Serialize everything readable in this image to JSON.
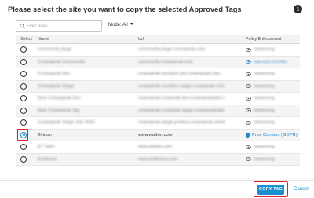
{
  "dialog": {
    "title": "Please select the site you want to copy the selected Approved Tags"
  },
  "toolbar": {
    "search_placeholder": "Find Sites",
    "mode_label": "Mode: All"
  },
  "table": {
    "headers": [
      "Select",
      "Name",
      "Url",
      "Policy Enforcement"
    ],
    "rows": [
      {
        "name": "community.stage",
        "url": "community.stage.crownpeak.com",
        "policy": "Observing",
        "selected": false,
        "readable": false,
        "policy_type": "observe"
      },
      {
        "name": "Crownpeak Community",
        "url": "community.crownpeak.com",
        "policy": "Opt-Out (CCPA)",
        "selected": false,
        "readable": false,
        "policy_type": "optout"
      },
      {
        "name": "Crownpeak Dev",
        "url": "crownpeak-scorpion.dev.crownpeak.com",
        "policy": "Observing",
        "selected": false,
        "readable": false,
        "policy_type": "observe"
      },
      {
        "name": "Crownpeak Stage",
        "url": "crownpeak-scorpion.stage.crownpeak.com",
        "policy": "Observing",
        "selected": false,
        "readable": false,
        "policy_type": "observe"
      },
      {
        "name": "New Crownpeak Dev",
        "url": "crownpeak.corporate.dev.crownpeaksites.com",
        "policy": "Observing",
        "selected": false,
        "readable": false,
        "policy_type": "observe"
      },
      {
        "name": "New Crownpeak Stg",
        "url": "crownpeak.corporate.stage.crownpeaksites.com",
        "policy": "Observing",
        "selected": false,
        "readable": false,
        "policy_type": "observe"
      },
      {
        "name": "Crownpeak Stage July 2020",
        "url": "crownpeak-stage.product.crownpeak.com/homepage",
        "policy": "Observing",
        "selected": false,
        "readable": false,
        "policy_type": "observe"
      },
      {
        "name": "Evidon",
        "url": "www.evidon.com",
        "policy": "Prior Consent (GDPR)",
        "selected": true,
        "readable": true,
        "policy_type": "consent"
      },
      {
        "name": "ET Sites",
        "url": "www.etsites.com",
        "policy": "Observing",
        "selected": false,
        "readable": false,
        "policy_type": "observe"
      },
      {
        "name": "Evidonna",
        "url": "www.evidonna.com",
        "policy": "Observing",
        "selected": false,
        "readable": false,
        "policy_type": "observe"
      }
    ]
  },
  "footer": {
    "copy_label": "COPY TAG",
    "cancel_label": "Cancel"
  },
  "colors": {
    "accent": "#1a8fd0",
    "highlight": "#d9232d"
  },
  "icons": {
    "info": "info-icon",
    "search": "search-icon",
    "observing": "eye-icon",
    "consent": "shield-icon"
  }
}
